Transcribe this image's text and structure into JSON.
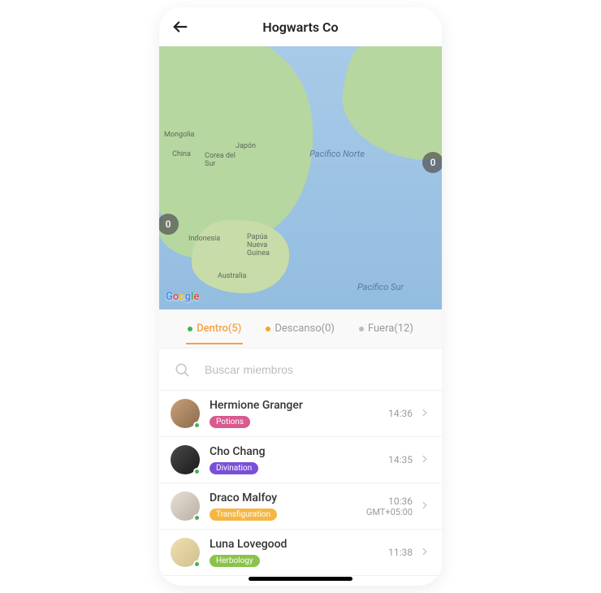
{
  "header": {
    "title": "Hogwarts Co"
  },
  "map": {
    "badges": {
      "left": "0",
      "right": "0"
    },
    "labels": {
      "mongolia": "Mongolia",
      "china": "China",
      "japon": "Japón",
      "corea": "Corea del Sur",
      "indonesia": "Indonesia",
      "australia": "Australia",
      "papua": "Papúa Nueva Guinea",
      "pacifico_norte": "Pacífico Norte",
      "pacifico_sur": "Pacífico Sur"
    },
    "attribution": "Google"
  },
  "tabs": [
    {
      "key": "dentro",
      "label": "Dentro(5)",
      "dot": "green",
      "active": true
    },
    {
      "key": "descanso",
      "label": "Descanso(0)",
      "dot": "orange",
      "active": false
    },
    {
      "key": "fuera",
      "label": "Fuera(12)",
      "dot": "gray",
      "active": false
    }
  ],
  "search": {
    "placeholder": "Buscar miembros"
  },
  "members": [
    {
      "name": "Hermione Granger",
      "tag": "Potions",
      "tag_color": "#d85a8f",
      "time": "14:36",
      "tz": "",
      "avatar_bg": "linear-gradient(135deg,#c9a07a,#8a6a4a)"
    },
    {
      "name": "Cho Chang",
      "tag": "Divination",
      "tag_color": "#7a4fd8",
      "time": "14:35",
      "tz": "",
      "avatar_bg": "linear-gradient(135deg,#4a4a4a,#1a1a1a)"
    },
    {
      "name": "Draco Malfoy",
      "tag": "Transfiguration",
      "tag_color": "#f5b642",
      "time": "10:36",
      "tz": "GMT+05:00",
      "avatar_bg": "linear-gradient(135deg,#e8e0d4,#b8b0a4)"
    },
    {
      "name": "Luna Lovegood",
      "tag": "Herbology",
      "tag_color": "#8bc34a",
      "time": "11:38",
      "tz": "",
      "avatar_bg": "linear-gradient(135deg,#f0e0b0,#d0c090)"
    }
  ]
}
